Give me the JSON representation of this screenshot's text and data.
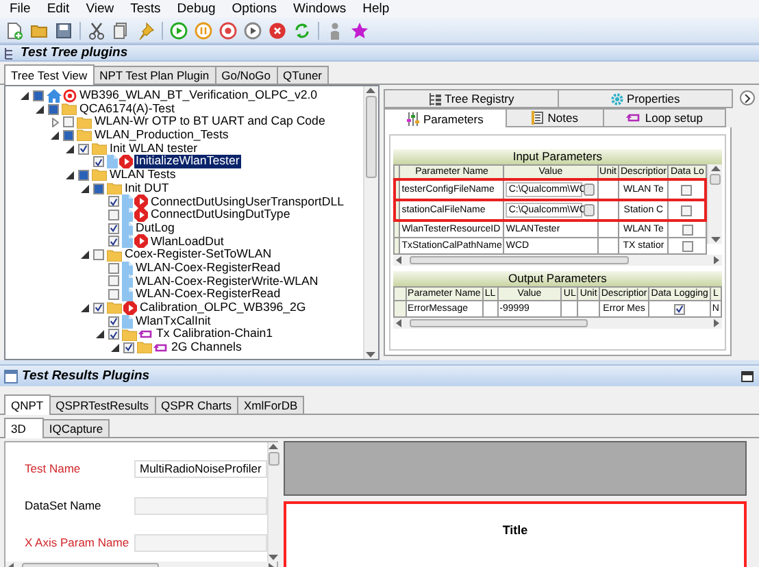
{
  "menu": [
    "File",
    "Edit",
    "View",
    "Tests",
    "Debug",
    "Options",
    "Windows",
    "Help"
  ],
  "tree_panel": {
    "title": "Test Tree plugins",
    "tabs": [
      {
        "label": "Tree Test View",
        "selected": true
      },
      {
        "label": "NPT Test Plan Plugin",
        "selected": false
      },
      {
        "label": "Go/NoGo",
        "selected": false
      },
      {
        "label": "QTuner",
        "selected": false
      }
    ],
    "tree": [
      {
        "label": "WB396_WLAN_BT_Verification_OLPC_v2.0",
        "checked": false,
        "indeterminate": true,
        "expanded": true,
        "kind": "home",
        "runnable": true,
        "selected": false,
        "children": [
          {
            "label": "QCA6174(A)-Test",
            "checked": false,
            "indeterminate": true,
            "expanded": true,
            "kind": "folder",
            "selected": false,
            "children": [
              {
                "label": "WLAN-Wr OTP to BT UART and Cap Code",
                "checked": false,
                "expanded": false,
                "kind": "folder",
                "selected": false
              },
              {
                "label": "WLAN_Production_Tests",
                "checked": false,
                "indeterminate": true,
                "expanded": true,
                "kind": "folder",
                "selected": false,
                "children": [
                  {
                    "label": "Init WLAN tester",
                    "checked": true,
                    "expanded": true,
                    "kind": "folder",
                    "selected": false,
                    "children": [
                      {
                        "label": "InitializeWlanTester",
                        "checked": true,
                        "kind": "file",
                        "runnable": true,
                        "selected": true
                      }
                    ]
                  },
                  {
                    "label": "WLAN Tests",
                    "checked": false,
                    "indeterminate": true,
                    "expanded": true,
                    "kind": "folder",
                    "selected": false,
                    "children": [
                      {
                        "label": "Init DUT",
                        "checked": false,
                        "indeterminate": true,
                        "expanded": true,
                        "kind": "folder",
                        "selected": false,
                        "children": [
                          {
                            "label": "ConnectDutUsingUserTransportDLL",
                            "checked": true,
                            "kind": "file",
                            "runnable": true,
                            "selected": false
                          },
                          {
                            "label": "ConnectDutUsingDutType",
                            "checked": false,
                            "kind": "file",
                            "runnable": true,
                            "selected": false
                          },
                          {
                            "label": "DutLog",
                            "checked": true,
                            "kind": "file",
                            "selected": false
                          },
                          {
                            "label": "WlanLoadDut",
                            "checked": true,
                            "kind": "file",
                            "runnable": true,
                            "selected": false
                          }
                        ]
                      },
                      {
                        "label": "Coex-Register-SetToWLAN",
                        "checked": false,
                        "expanded": true,
                        "kind": "folder",
                        "selected": false,
                        "children": [
                          {
                            "label": "WLAN-Coex-RegisterRead",
                            "checked": false,
                            "kind": "file",
                            "selected": false
                          },
                          {
                            "label": "WLAN-Coex-RegisterWrite-WLAN",
                            "checked": false,
                            "kind": "file",
                            "selected": false
                          },
                          {
                            "label": "WLAN-Coex-RegisterRead",
                            "checked": false,
                            "kind": "file",
                            "selected": false
                          }
                        ]
                      },
                      {
                        "label": "Calibration_OLPC_WB396_2G",
                        "checked": true,
                        "expanded": true,
                        "kind": "folder",
                        "runnable": true,
                        "selected": false,
                        "children": [
                          {
                            "label": "WlanTxCalInit",
                            "checked": true,
                            "kind": "file",
                            "selected": false
                          },
                          {
                            "label": "Tx Calibration-Chain1",
                            "checked": true,
                            "expanded": true,
                            "kind": "folder",
                            "looped": true,
                            "selected": false,
                            "children": [
                              {
                                "label": "2G Channels",
                                "checked": true,
                                "expanded": true,
                                "kind": "folder",
                                "looped": true,
                                "selected": false
                              }
                            ]
                          }
                        ]
                      }
                    ]
                  }
                ]
              }
            ]
          }
        ]
      }
    ]
  },
  "properties_panel": {
    "tab_rows": [
      [
        {
          "label": "Tree Registry",
          "selected": false
        },
        {
          "label": "Properties",
          "selected": false
        }
      ],
      [
        {
          "label": "Parameters",
          "selected": true
        },
        {
          "label": "Notes",
          "selected": false
        },
        {
          "label": "Loop setup",
          "selected": false
        }
      ]
    ],
    "input_parameters": {
      "title": "Input Parameters",
      "columns": [
        "Parameter Name",
        "Value",
        "Unit",
        "Descriptior",
        "Data Lo"
      ],
      "rows": [
        {
          "name": "testerConfigFileName",
          "value": "C:\\Qualcomm\\WC",
          "browse": true,
          "description": "WLAN Te",
          "data_log": false,
          "highlighted": true
        },
        {
          "name": "stationCalFileName",
          "value": "C:\\Qualcomm\\WC",
          "browse": true,
          "description": "Station C",
          "data_log": false,
          "highlighted": true
        },
        {
          "name": "WlanTesterResourceID",
          "value": "WLANTester",
          "browse": false,
          "description": "WLAN Te",
          "data_log": false,
          "highlighted": false
        },
        {
          "name": "TxStationCalPathName",
          "value": "WCD",
          "browse": false,
          "description": "TX statior",
          "data_log": false,
          "highlighted": false
        }
      ]
    },
    "output_parameters": {
      "title": "Output Parameters",
      "columns": [
        "Parameter Name",
        "LL",
        "Value",
        "UL",
        "Unit",
        "Descriptior",
        "Data Logging",
        "L"
      ],
      "rows": [
        {
          "name": "ErrorMessage",
          "value": "-99999",
          "description": "Error Mes",
          "data_logging": true,
          "column_9": "N"
        }
      ]
    }
  },
  "results_panel": {
    "title": "Test Results Plugins",
    "tabs": [
      {
        "label": "QNPT",
        "selected": true
      },
      {
        "label": "QSPRTestResults",
        "selected": false
      },
      {
        "label": "QSPR Charts",
        "selected": false
      },
      {
        "label": "XmlForDB",
        "selected": false
      }
    ],
    "subtabs": [
      {
        "label": "3D",
        "selected": true
      },
      {
        "label": "IQCapture",
        "selected": false
      }
    ],
    "fields": [
      {
        "label": "Test Name",
        "required": true,
        "value": "MultiRadioNoiseProfiler"
      },
      {
        "label": "DataSet Name",
        "required": false
      },
      {
        "label": "X Axis Param Name",
        "required": true
      }
    ],
    "plot_title": "Title"
  }
}
